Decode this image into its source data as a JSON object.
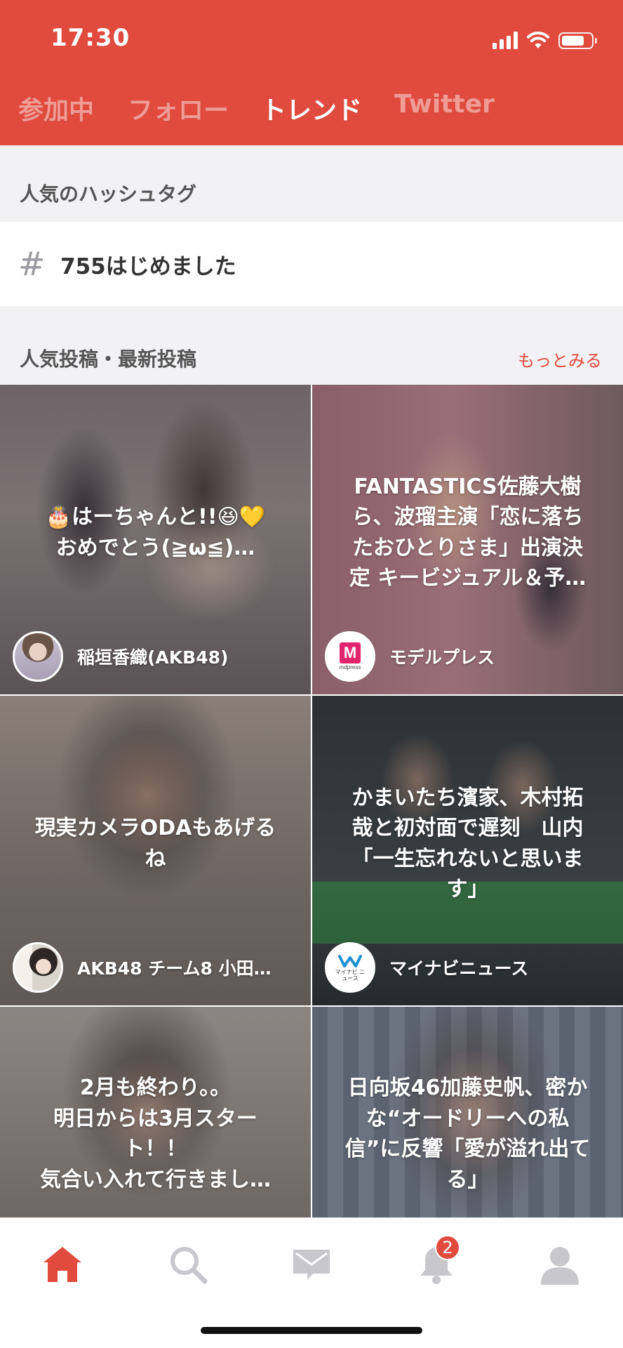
{
  "status": {
    "time": "17:30",
    "battery_level": 0.8
  },
  "tabs": [
    {
      "label": "参加中",
      "active": false
    },
    {
      "label": "フォロー",
      "active": false
    },
    {
      "label": "トレンド",
      "active": true
    },
    {
      "label": "Twitter",
      "active": false
    }
  ],
  "hashtags": {
    "title": "人気のハッシュタグ",
    "items": [
      {
        "symbol": "#",
        "text": "755はじめました"
      }
    ]
  },
  "posts": {
    "title": "人気投稿・最新投稿",
    "more_label": "もっとみる",
    "items": [
      {
        "title_lines": [
          "🎂はーちゃんと!!😆💛",
          "おめでとう(≧ω≦)…"
        ],
        "author": "稲垣香織(AKB48)"
      },
      {
        "title_lines": [
          "FANTASTICS佐藤大樹",
          "ら、波瑠主演「恋に落ち",
          "たおひとりさま」出演決",
          "定 キービジュアル＆予…"
        ],
        "author": "モデルプレス",
        "logo_text": "mdpress"
      },
      {
        "title_lines": [
          "現実カメラODAもあげる",
          "ね"
        ],
        "author": "AKB48 チーム8 小田…"
      },
      {
        "title_lines": [
          "かまいたち濱家、木村拓",
          "哉と初対面で遅刻　山内",
          "「一生忘れないと思いま",
          "す」"
        ],
        "author": "マイナビニュース",
        "logo_text": "マイナビ ニュース"
      },
      {
        "title_lines": [
          "2月も終わり。。",
          "明日からは3月スター",
          "ト！！",
          "気合い入れて行きまし…"
        ]
      },
      {
        "title_lines": [
          "日向坂46加藤史帆、密か",
          "な“オードリーへの私",
          "信”に反響「愛が溢れ出て",
          "る」"
        ]
      }
    ]
  },
  "nav": {
    "items": [
      "home-icon",
      "search-icon",
      "mail-icon",
      "bell-icon",
      "profile-icon"
    ],
    "notification_count": "2"
  },
  "colors": {
    "accent": "#e04b3e",
    "inactive_icon": "#c8c8cc"
  }
}
